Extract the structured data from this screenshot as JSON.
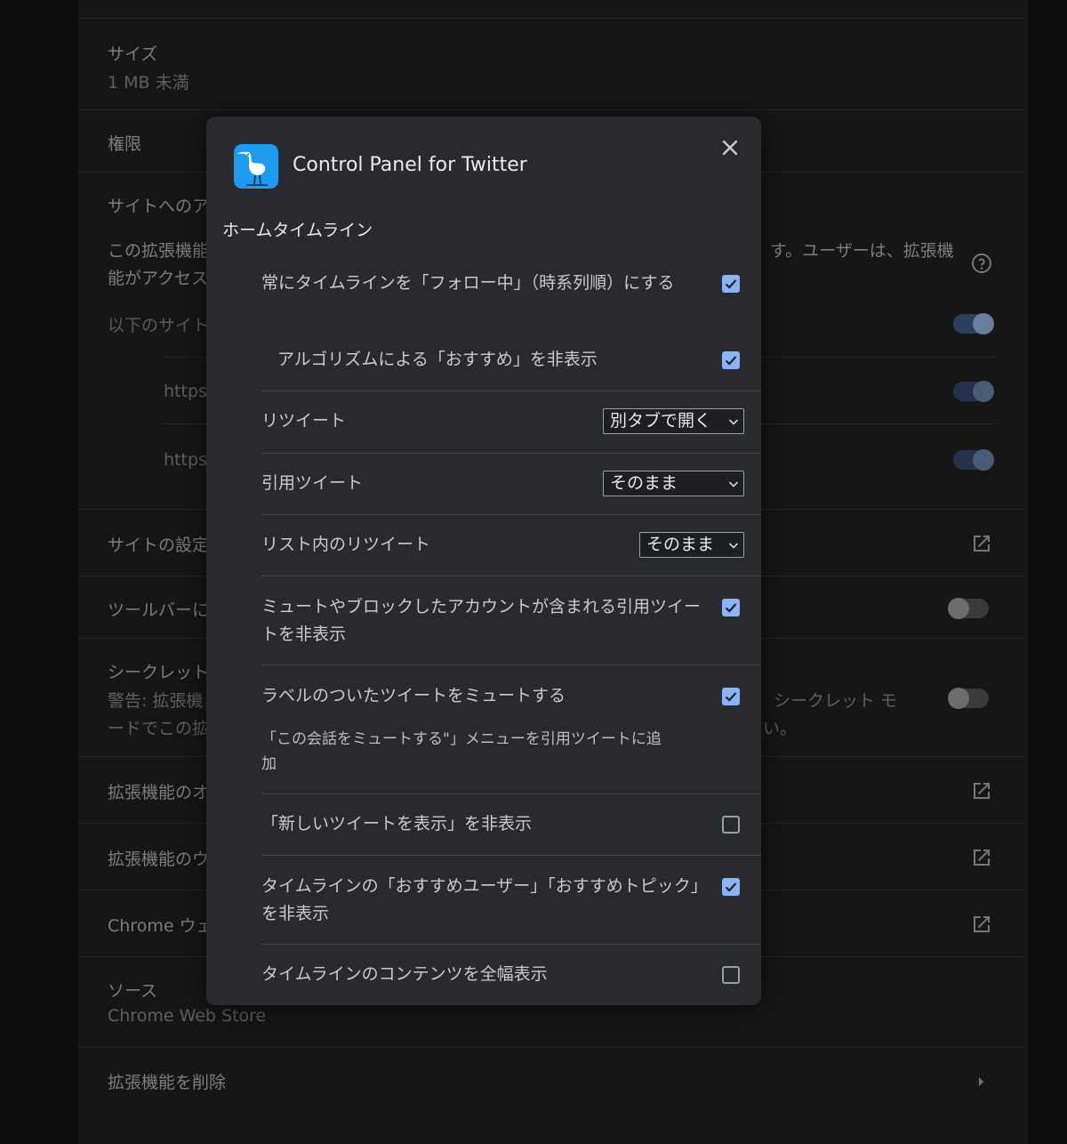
{
  "background_page": {
    "rows": [
      {
        "label": "サイズ",
        "sub": "1 MB 未満"
      },
      {
        "label": "権限"
      },
      {
        "label": "サイトへのア"
      },
      {
        "label": "この拡張機能",
        "line2": "能がアクセス"
      },
      {
        "label": "以下のサイト"
      },
      {
        "label": "https"
      },
      {
        "label": "https"
      },
      {
        "label": "サイトの設定"
      },
      {
        "label": "ツールバーに"
      },
      {
        "label": "シークレット",
        "line2": "警告: 拡張機",
        "line3": "ードでこの拡"
      },
      {
        "label": "拡張機能のオ"
      },
      {
        "label": "拡張機能のウ"
      },
      {
        "label": "Chrome ウェ"
      },
      {
        "label": "ソース",
        "sub": "Chrome Web Store"
      },
      {
        "label": "拡張機能を削除"
      }
    ],
    "right_text_1": "す。ユーザーは、拡張機",
    "right_text_2": "シークレット モ",
    "right_text_3": "い。"
  },
  "modal": {
    "title": "Control Panel for Twitter",
    "section_title": "ホームタイムライン",
    "options": [
      {
        "label": "常にタイムラインを「フォロー中」（時系列順）にする",
        "checked": true
      },
      {
        "label": "アルゴリズムによる「おすすめ」を非表示",
        "checked": true
      },
      {
        "label": "リツイート",
        "select": "別タブで開く"
      },
      {
        "label": "引用ツイート",
        "select": "そのまま"
      },
      {
        "label": "リスト内のリツイート",
        "select": "そのまま"
      },
      {
        "label": "ミュートやブロックしたアカウントが含まれる引用ツイートを非表示",
        "checked": true
      },
      {
        "label": "ラベルのついたツイートをミュートする",
        "checked": true,
        "desc": "「この会話をミュートする\"」メニューを引用ツイートに追加"
      },
      {
        "label": "「新しいツイートを表示」を非表示",
        "checked": false
      },
      {
        "label": "タイムラインの「おすすめユーザー」「おすすめトピック」を非表示",
        "checked": true
      },
      {
        "label": "タイムラインのコンテンツを全幅表示",
        "checked": false
      }
    ]
  },
  "colors": {
    "modal_bg": "#292a2d",
    "checkbox_checked": "#8ab4f8",
    "app_icon_bg": "#1d9bf0"
  },
  "icons": {
    "app": "heron-bird-icon",
    "close": "close-icon",
    "external_link": "open-in-new-icon",
    "help": "help-circle-icon",
    "chevron": "chevron-down-icon"
  }
}
